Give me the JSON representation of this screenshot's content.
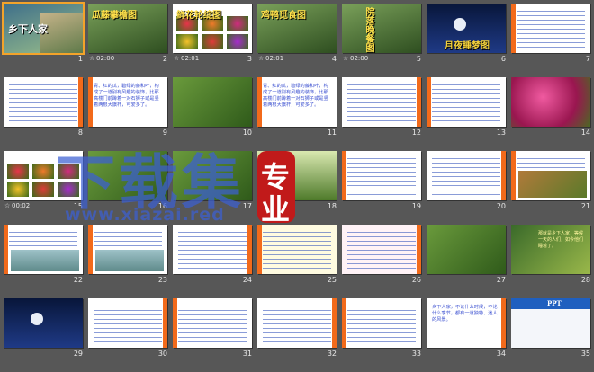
{
  "slides": [
    {
      "n": "1",
      "title": "乡下人家",
      "theme": "cover"
    },
    {
      "n": "2",
      "title": "瓜藤攀檐图",
      "timing": "02:00",
      "star": "☆",
      "theme": "photo-title"
    },
    {
      "n": "3",
      "title": "鲜花轮绽图",
      "timing": "02:01",
      "star": "☆",
      "theme": "flowers"
    },
    {
      "n": "4",
      "title": "鸡鸭觅食图",
      "timing": "02:01",
      "star": "☆",
      "theme": "photo-title"
    },
    {
      "n": "5",
      "title": "院落晚餐图",
      "timing": "02:00",
      "star": "☆",
      "theme": "photo-title-v"
    },
    {
      "n": "6",
      "title": "月夜睡梦图",
      "theme": "night"
    },
    {
      "n": "7",
      "theme": "text"
    },
    {
      "n": "8",
      "theme": "text"
    },
    {
      "n": "9",
      "text": "青、红的瓜，碧绿的藤和叶，构成了一道别有风趣的装饰，比那高楼门前蹲着一对石狮子或是竖着两根大旗杆，可爱多了。",
      "theme": "text-big"
    },
    {
      "n": "10",
      "theme": "photo"
    },
    {
      "n": "11",
      "text": "青、红的瓜，碧绿的藤和叶，构成了一道别有风趣的装饰，比那高楼门前蹲着一对石狮子或是竖着两根大旗杆，可爱多了。",
      "theme": "text-big"
    },
    {
      "n": "12",
      "theme": "text"
    },
    {
      "n": "13",
      "theme": "text"
    },
    {
      "n": "14",
      "theme": "photo-pink"
    },
    {
      "n": "15",
      "timing": "00:02",
      "star": "☆",
      "theme": "flowers"
    },
    {
      "n": "16",
      "theme": "photo"
    },
    {
      "n": "17",
      "theme": "photo"
    },
    {
      "n": "18",
      "theme": "photo-green"
    },
    {
      "n": "19",
      "theme": "text"
    },
    {
      "n": "20",
      "theme": "text"
    },
    {
      "n": "21",
      "theme": "photo-brown"
    },
    {
      "n": "22",
      "theme": "text-photo"
    },
    {
      "n": "23",
      "theme": "text-photo"
    },
    {
      "n": "24",
      "theme": "text"
    },
    {
      "n": "25",
      "theme": "text-yellow"
    },
    {
      "n": "26",
      "theme": "text-pink"
    },
    {
      "n": "27",
      "theme": "photo"
    },
    {
      "n": "28",
      "text": "那就是乡下人家，等候一天的人们，如今他们睡着了。",
      "theme": "photo-text"
    },
    {
      "n": "29",
      "theme": "night-text"
    },
    {
      "n": "30",
      "theme": "text"
    },
    {
      "n": "31",
      "theme": "text"
    },
    {
      "n": "32",
      "theme": "text"
    },
    {
      "n": "33",
      "theme": "text"
    },
    {
      "n": "34",
      "text": "乡下人家，不论什么时候，不论什么季节，都有一道独特、迷人的风景。",
      "theme": "text-big"
    },
    {
      "n": "35",
      "title": "PPT",
      "theme": "end"
    }
  ],
  "watermark": {
    "main": "下载集",
    "url": "www.xiazai.red",
    "badge_line1": "专",
    "badge_line2": "业"
  },
  "colors": {
    "background": "#575757",
    "selection": "#f3a32a",
    "accent_orange": "#f26a1b",
    "text_blue": "#1e40a8",
    "watermark_blue": "#3f5fd0",
    "badge_red": "#c11a1a"
  },
  "selected_slide": "1"
}
